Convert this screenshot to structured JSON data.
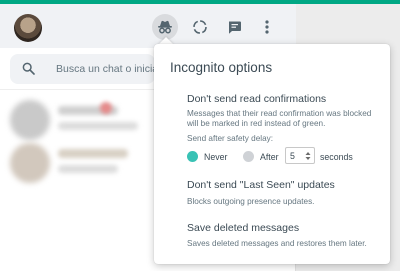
{
  "search": {
    "placeholder": "Busca un chat o inicia u"
  },
  "popup": {
    "title": "Incognito options",
    "read_confirmations": {
      "title": "Don't send read confirmations",
      "description": "Messages that their read confirmation was blocked will be marked in red instead of green.",
      "delay_label": "Send after safety delay:",
      "never_label": "Never",
      "after_label": "After",
      "after_value": "5",
      "seconds_label": "seconds",
      "selected": "never"
    },
    "last_seen": {
      "title": "Don't send \"Last Seen\" updates",
      "description": "Blocks outgoing presence updates."
    },
    "deleted_messages": {
      "title": "Save deleted messages",
      "description": "Saves deleted messages and restores them later."
    }
  },
  "colors": {
    "brand_green": "#00a884",
    "radio_selected": "#39c2b5"
  }
}
